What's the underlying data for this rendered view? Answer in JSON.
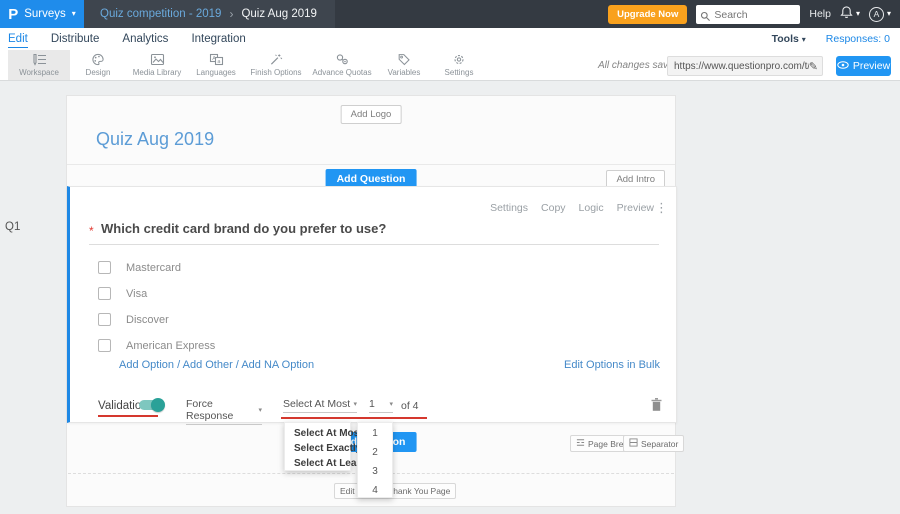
{
  "navbar": {
    "logo_text": "P",
    "product": "Surveys",
    "breadcrumb": {
      "parent": "Quiz competition - 2019",
      "separator": "›",
      "current": "Quiz Aug 2019"
    },
    "upgrade": "Upgrade Now",
    "search_placeholder": "Search",
    "help": "Help",
    "avatar_initial": "A"
  },
  "tabs": {
    "items": [
      "Edit",
      "Distribute",
      "Analytics",
      "Integration"
    ],
    "tools": "Tools",
    "responses": "Responses: 0"
  },
  "toolbar": {
    "items": [
      {
        "label": "Workspace",
        "icon": "workspace-icon"
      },
      {
        "label": "Design",
        "icon": "design-icon"
      },
      {
        "label": "Media Library",
        "icon": "media-library-icon"
      },
      {
        "label": "Languages",
        "icon": "languages-icon"
      },
      {
        "label": "Finish Options",
        "icon": "finish-options-icon"
      },
      {
        "label": "Advance Quotas",
        "icon": "advance-quotas-icon"
      },
      {
        "label": "Variables",
        "icon": "variables-icon"
      },
      {
        "label": "Settings",
        "icon": "settings-icon"
      }
    ],
    "saved_status": "All changes saved",
    "share_url": "https://www.questionpro.com/t/APNrFZ",
    "preview_button": "Preview"
  },
  "survey": {
    "add_logo": "Add Logo",
    "title": "Quiz Aug 2019",
    "add_question": "Add Question",
    "add_intro": "Add Intro",
    "question": {
      "id": "Q1",
      "required_marker": "*",
      "actions": [
        "Settings",
        "Copy",
        "Logic",
        "Preview"
      ],
      "text": "Which credit card brand do you prefer to use?",
      "options": [
        "Mastercard",
        "Visa",
        "Discover",
        "American Express"
      ],
      "option_links": [
        "Add Option",
        "Add Other",
        "Add NA Option"
      ],
      "links_separator": " / ",
      "bulk_edit": "Edit Options in Bulk",
      "validation_label": "Validation",
      "force_response": "Force Response",
      "rule_selected": "Select At Most",
      "count_selected": "1",
      "of_total": "of 4"
    },
    "rule_menu": [
      "Select At Most",
      "Select Exactly",
      "Select At Least"
    ],
    "number_menu": [
      "1",
      "2",
      "3",
      "4"
    ],
    "page_break": "Page Break",
    "separator": "Separator",
    "edit_footer": "Edit Footer",
    "thank_you_page": "Thank You Page"
  },
  "colors": {
    "accent_blue": "#2196f3",
    "brand_blue": "#1f8ceb",
    "upgrade_orange": "#f9a11d",
    "toggle_teal": "#2aa198",
    "annotation_red": "#d5382e",
    "navbar_dark": "#343a42"
  }
}
